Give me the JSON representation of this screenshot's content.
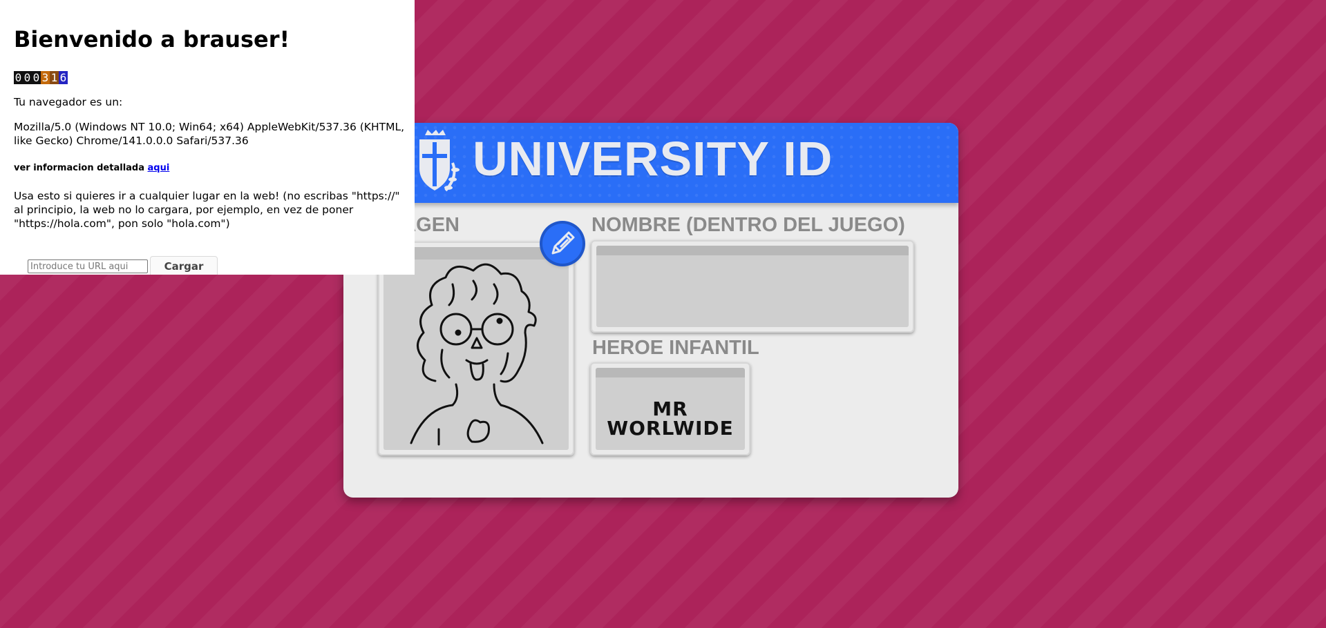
{
  "colors": {
    "background": "#ac235a",
    "card_header": "#2a6ef7",
    "card_body": "#ececec"
  },
  "card": {
    "title": "UNIVERSITY ID",
    "image_label": "IMAGEN",
    "name_label": "NOMBRE (DENTRO DEL JUEGO)",
    "hero_label": "HEROE INFANTIL",
    "hero_line1": "MR",
    "hero_line2": "WORLWIDE",
    "edit_icon": "pencil-icon"
  },
  "panel": {
    "heading": "Bienvenido a brauser!",
    "counter": [
      "0",
      "0",
      "0",
      "3",
      "1",
      "6"
    ],
    "browser_label": "Tu navegador es un:",
    "user_agent": "Mozilla/5.0 (Windows NT 10.0; Win64; x64) AppleWebKit/537.36 (KHTML, like Gecko) Chrome/141.0.0.0 Safari/537.36",
    "details_text": "ver informacion detallada ",
    "details_link": "aqui",
    "instructions": "Usa esto si quieres ir a cualquier lugar en la web! (no escribas \"https://\" al principio, la web no lo cargara, por ejemplo, en vez de poner \"https://hola.com\", pon solo \"hola.com\")",
    "url_placeholder": "Introduce tu URL aqui",
    "load_button": "Cargar"
  }
}
